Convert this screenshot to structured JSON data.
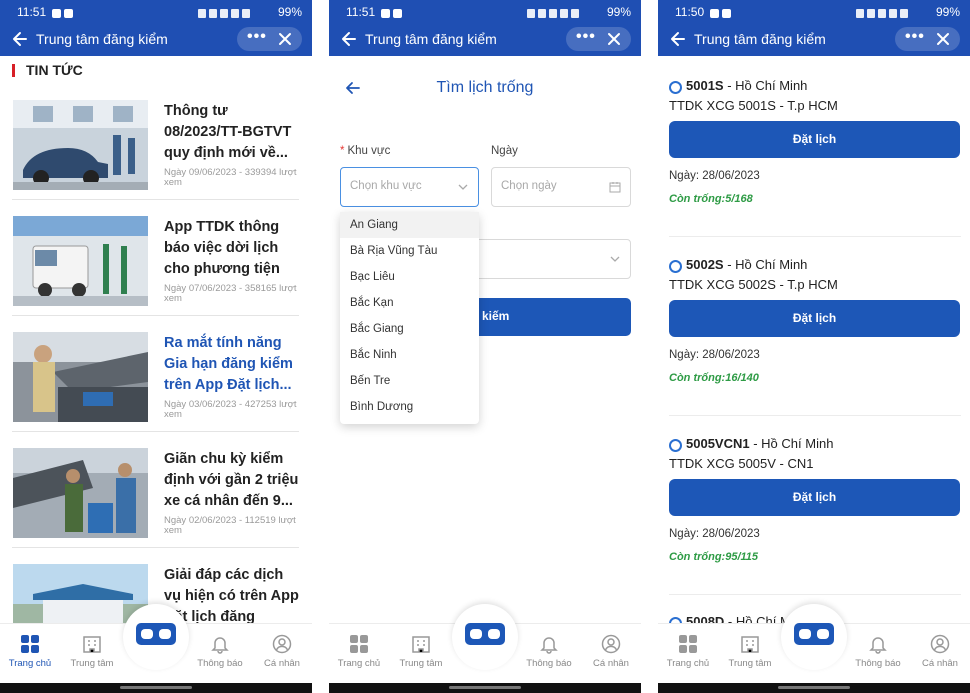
{
  "status_panels": [
    {
      "time": "11:51",
      "battery": "99%"
    },
    {
      "time": "11:51",
      "battery": "99%"
    },
    {
      "time": "11:50",
      "battery": "99%"
    }
  ],
  "appbar": {
    "title": "Trung tâm đăng kiểm",
    "more": "•••"
  },
  "news_section": {
    "title": "TIN TỨC"
  },
  "news": [
    {
      "headline": "Thông tư 08/2023/TT-BGTVT quy định mới về...",
      "meta": "Ngày 09/06/2023 - 339394 lượt xem"
    },
    {
      "headline": "App TTDK thông báo việc dời lịch cho phương tiện đã...",
      "meta": "Ngày 07/06/2023 - 358165 lượt xem"
    },
    {
      "headline": "Ra mắt tính năng Gia hạn đăng kiểm trên App Đặt lịch...",
      "meta": "Ngày 03/06/2023 - 427253 lượt xem"
    },
    {
      "headline": "Giãn chu kỳ kiểm định với gần 2 triệu xe cá nhân đến 9...",
      "meta": "Ngày 02/06/2023 - 112519 lượt xem"
    },
    {
      "headline": "Giải đáp các dịch vụ hiện có trên App Đặt lịch đăng kiểm...",
      "meta": ""
    }
  ],
  "nav": {
    "home": "Trang chủ",
    "center": "Trung tâm",
    "notifications": "Thông báo",
    "profile": "Cá nhân"
  },
  "search_form": {
    "title": "Tìm lịch trống",
    "region_label": "Khu vực",
    "region_placeholder": "Chọn khu vực",
    "date_label": "Ngày",
    "date_placeholder": "Chọn ngày",
    "search_button_visible": "kiếm",
    "region_options": [
      "An Giang",
      "Bà Rịa Vũng Tàu",
      "Bạc Liêu",
      "Bắc Kạn",
      "Bắc Giang",
      "Bắc Ninh",
      "Bến Tre",
      "Bình Dương"
    ]
  },
  "stations": [
    {
      "code": "5001S",
      "city": "Hồ Chí Minh",
      "name": "TTDK XCG 5001S - T.p HCM",
      "button": "Đặt lịch",
      "date": "Ngày: 28/06/2023",
      "available": "Còn trống:5/168"
    },
    {
      "code": "5002S",
      "city": "Hồ Chí Minh",
      "name": "TTDK XCG 5002S - T.p HCM",
      "button": "Đặt lịch",
      "date": "Ngày: 28/06/2023",
      "available": "Còn trống:16/140"
    },
    {
      "code": "5005VCN1",
      "city": "Hồ Chí Minh",
      "name": "TTDK XCG 5005V - CN1",
      "button": "Đặt lịch",
      "date": "Ngày: 28/06/2023",
      "available": "Còn trống:95/115"
    },
    {
      "code": "5008D",
      "city": "Hồ Chí M"
    }
  ],
  "colors": {
    "primary": "#1f4fb3",
    "accent_button": "#1d57b7",
    "available_green": "#2e9b45",
    "required_red": "#e53935"
  }
}
